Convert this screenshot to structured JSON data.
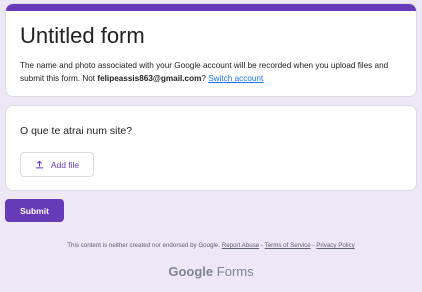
{
  "header": {
    "title": "Untitled form",
    "notice_prefix": "The name and photo associated with your Google account will be recorded when you upload files and submit this form. Not ",
    "email": "felipeassis863@gmail.com",
    "notice_suffix": "? ",
    "switch_account": "Switch account",
    "accent_color": "#673ab7"
  },
  "question": {
    "title": "O que te atrai num site?",
    "add_file_label": "Add file",
    "add_file_icon": "upload-icon"
  },
  "submit_label": "Submit",
  "footer": {
    "text": "This content is neither created nor endorsed by Google.",
    "report_abuse": "Report Abuse",
    "separator": " - ",
    "terms": "Terms of Service",
    "privacy": "Privacy Policy"
  },
  "brand": {
    "google": "Google",
    "forms": "Forms"
  }
}
